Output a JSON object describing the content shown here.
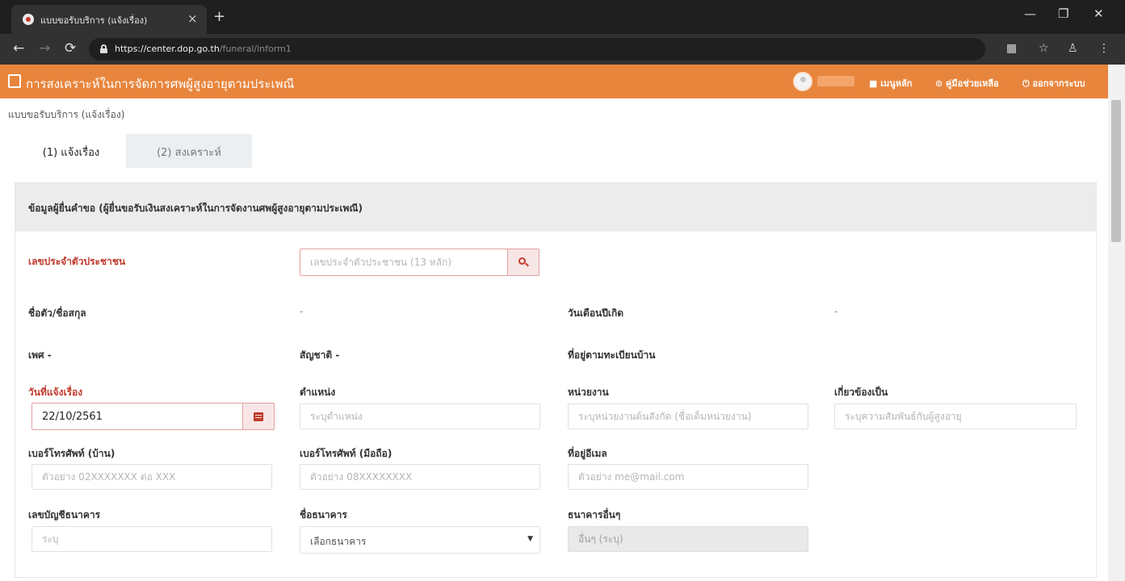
{
  "browser": {
    "tab_title": "แบบขอรับบริการ (แจ้งเรื่อง)",
    "url_host": "https://center.dop.go.th",
    "url_path": "/funeral/inform1",
    "new_tab_glyph": "+",
    "tab_close_glyph": "×",
    "window_controls": {
      "minimize": "—",
      "maximize": "❐",
      "close": "✕"
    },
    "nav_glyphs": {
      "back": "←",
      "forward": "→",
      "reload": "⟳"
    },
    "toolbar_glyphs": {
      "translate": "▦",
      "bookmark": "☆",
      "account": "♙",
      "menu": "⋮"
    }
  },
  "app": {
    "title": "การสงเคราะห์ในการจัดการศพผู้สูงอายุตามประเพณี",
    "brand_color": "#e8853d",
    "nav": {
      "home": "■ เมนูหลัก",
      "manual": "⊙ คู่มือช่วยเหลือ",
      "logout": "⏻ ออกจากระบบ"
    }
  },
  "page": {
    "breadcrumb": "แบบขอรับบริการ (แจ้งเรื่อง)",
    "tabs": [
      {
        "label": "(1) แจ้งเรื่อง",
        "active": true
      },
      {
        "label": "(2) สงเคราะห์",
        "active": false
      }
    ],
    "section_title": "ข้อมูลผู้ยื่นคำขอ (ผู้ยื่นขอรับเงินสงเคราะห์ในการจัดงานศพผู้สูงอายุตามประเพณี)",
    "form": {
      "id_card": {
        "label": "เลขประจำตัวประชาชน",
        "placeholder": "เลขประจำตัวประชาชน (13 หลัก)"
      },
      "name": {
        "label": "ชื่อตัว/ชื่อสกุล",
        "value": "-"
      },
      "birthdate": {
        "label": "วันเดือนปีเกิด",
        "value": "-"
      },
      "gender": {
        "label": "เพศ -"
      },
      "nationality": {
        "label": "สัญชาติ -"
      },
      "address": {
        "label": "ที่อยู่ตามทะเบียนบ้าน"
      },
      "inform_date": {
        "label": "วันที่แจ้งเรื่อง",
        "value": "22/10/2561"
      },
      "position": {
        "label": "ตำแหน่ง",
        "placeholder": "ระบุตำแหน่ง"
      },
      "agency": {
        "label": "หน่วยงาน",
        "placeholder": "ระบุหน่วยงานต้นสังกัด (ชื่อเต็มหน่วยงาน)"
      },
      "relation": {
        "label": "เกี่ยวข้องเป็น",
        "placeholder": "ระบุความสัมพันธ์กับผู้สูงอายุ"
      },
      "phone_home": {
        "label": "เบอร์โทรศัพท์ (บ้าน)",
        "placeholder": "ตัวอย่าง 02XXXXXXX ต่อ XXX"
      },
      "phone_mobile": {
        "label": "เบอร์โทรศัพท์ (มือถือ)",
        "placeholder": "ตัวอย่าง 08XXXXXXXX"
      },
      "email": {
        "label": "ที่อยู่อีเมล",
        "placeholder": "ตัวอย่าง me@mail.com"
      },
      "bank_account": {
        "label": "เลขบัญชีธนาคาร",
        "placeholder": "ระบุ"
      },
      "bank_name": {
        "label": "ชื่อธนาคาร",
        "selected": "เลือกธนาคาร"
      },
      "bank_other": {
        "label": "ธนาคารอื่นๆ",
        "placeholder": "อื่นๆ (ระบุ)"
      }
    }
  },
  "icons": {
    "search": "search-icon",
    "calendar": "calendar-icon",
    "dropdown": "chevron-down-icon"
  }
}
